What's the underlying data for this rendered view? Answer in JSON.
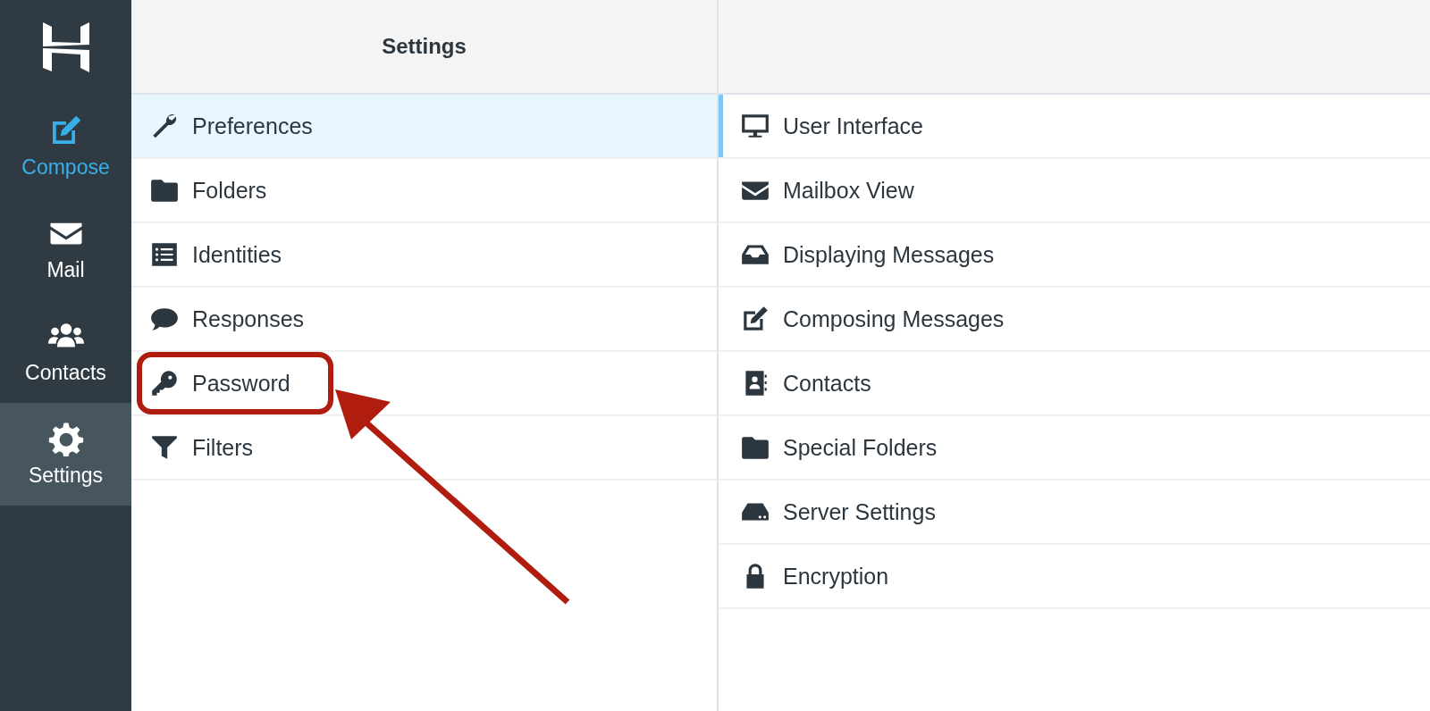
{
  "nav": [
    {
      "label": "Compose",
      "selected": false,
      "active": true
    },
    {
      "label": "Mail",
      "selected": false,
      "active": false
    },
    {
      "label": "Contacts",
      "selected": false,
      "active": false
    },
    {
      "label": "Settings",
      "selected": true,
      "active": false
    }
  ],
  "settings": {
    "title": "Settings",
    "items": [
      {
        "label": "Preferences",
        "selected": true,
        "highlighted": false
      },
      {
        "label": "Folders",
        "selected": false,
        "highlighted": false
      },
      {
        "label": "Identities",
        "selected": false,
        "highlighted": false
      },
      {
        "label": "Responses",
        "selected": false,
        "highlighted": false
      },
      {
        "label": "Password",
        "selected": false,
        "highlighted": true
      },
      {
        "label": "Filters",
        "selected": false,
        "highlighted": false
      }
    ]
  },
  "sections": [
    {
      "label": "User Interface",
      "selected": true
    },
    {
      "label": "Mailbox View",
      "selected": false
    },
    {
      "label": "Displaying Messages",
      "selected": false
    },
    {
      "label": "Composing Messages",
      "selected": false
    },
    {
      "label": "Contacts",
      "selected": false
    },
    {
      "label": "Special Folders",
      "selected": false
    },
    {
      "label": "Server Settings",
      "selected": false
    },
    {
      "label": "Encryption",
      "selected": false
    }
  ]
}
